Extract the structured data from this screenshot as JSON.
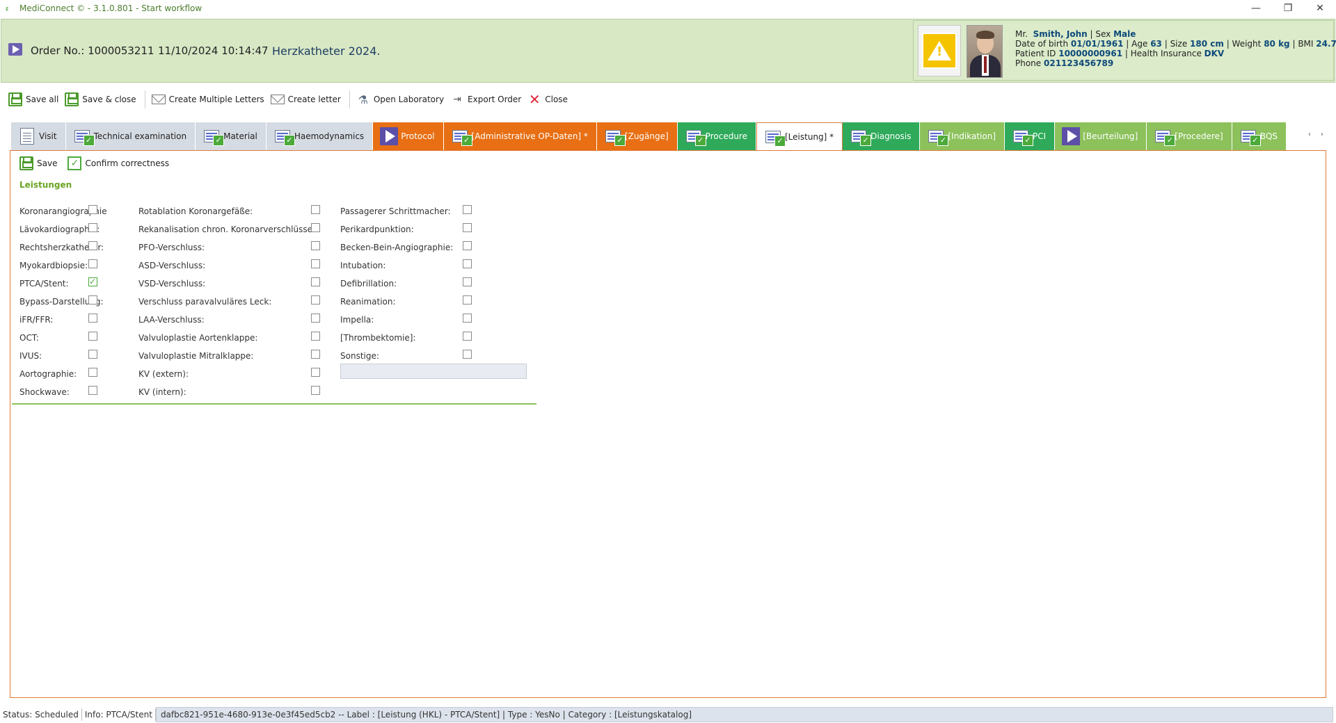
{
  "window": {
    "title": "MediConnect © - 3.1.0.801 - Start workflow",
    "controls": [
      "minimize",
      "restore",
      "close"
    ]
  },
  "header": {
    "order_label": "Order No.: 1000053211",
    "order_datetime": "11/10/2024 10:14:47",
    "workflow_name": "Herzkatheter 2024."
  },
  "patient": {
    "salutation": "Mr.",
    "name": "Smith, John",
    "sex_label": "Sex",
    "sex": "Male",
    "dob_label": "Date of birth",
    "dob": "01/01/1961",
    "age_label": "Age",
    "age": "63",
    "size_label": "Size",
    "size": "180 cm",
    "weight_label": "Weight",
    "weight": "80 kg",
    "bmi_label": "BMI",
    "bmi": "24.7",
    "pid_label": "Patient ID",
    "pid": "10000000961",
    "insurance_label": "Health Insurance",
    "insurance": "DKV",
    "phone_label": "Phone",
    "phone": "021123456789"
  },
  "toolbar": {
    "save_all": "Save all",
    "save_close": "Save & close",
    "create_multiple": "Create Multiple Letters",
    "create_letter": "Create letter",
    "open_lab": "Open Laboratory",
    "export_order": "Export Order",
    "close": "Close"
  },
  "tabs": [
    {
      "label": "Visit",
      "style": "gray",
      "icon": "document-icon"
    },
    {
      "label": "Technical examination",
      "style": "gray",
      "icon": "calendar-check-icon"
    },
    {
      "label": "Material",
      "style": "gray",
      "icon": "calendar-check-icon"
    },
    {
      "label": "Haemodynamics",
      "style": "gray",
      "icon": "calendar-check-icon"
    },
    {
      "label": "Protocol",
      "style": "orange",
      "icon": "play-icon"
    },
    {
      "label": "[Administrative OP-Daten] *",
      "style": "orange",
      "icon": "calendar-check-icon"
    },
    {
      "label": "[Zugänge]",
      "style": "orange",
      "icon": "calendar-check-icon"
    },
    {
      "label": "Procedure",
      "style": "green",
      "icon": "calendar-check-icon"
    },
    {
      "label": "[Leistung] *",
      "style": "active",
      "icon": "calendar-check-icon"
    },
    {
      "label": "Diagnosis",
      "style": "green",
      "icon": "calendar-check-icon"
    },
    {
      "label": "[Indikation]",
      "style": "olive",
      "icon": "calendar-check-icon"
    },
    {
      "label": "PCI",
      "style": "green",
      "icon": "calendar-check-icon"
    },
    {
      "label": "[Beurteilung]",
      "style": "olive",
      "icon": "play-icon"
    },
    {
      "label": "[Procedere]",
      "style": "olive",
      "icon": "calendar-check-icon"
    },
    {
      "label": "BQS",
      "style": "olive",
      "icon": "calendar-check-icon"
    }
  ],
  "tab_nav": {
    "prev": "‹",
    "next": "›"
  },
  "panel": {
    "save": "Save",
    "confirm": "Confirm correctness",
    "section_title": "Leistungen"
  },
  "form": {
    "col1": [
      {
        "label": "Koronarangiographie",
        "checked": false
      },
      {
        "label": "Lävokardiographie:",
        "checked": false
      },
      {
        "label": "Rechtsherzkatheter:",
        "checked": false
      },
      {
        "label": "Myokardbiopsie:",
        "checked": false
      },
      {
        "label": "PTCA/Stent:",
        "checked": true
      },
      {
        "label": "Bypass-Darstellung:",
        "checked": false
      },
      {
        "label": "iFR/FFR:",
        "checked": false
      },
      {
        "label": "OCT:",
        "checked": false
      },
      {
        "label": "IVUS:",
        "checked": false
      },
      {
        "label": "Aortographie:",
        "checked": false
      },
      {
        "label": "Shockwave:",
        "checked": false
      }
    ],
    "col2": [
      {
        "label": "Rotablation Koronargefäße:",
        "checked": false
      },
      {
        "label": "Rekanalisation chron. Koronarverschlüsse:",
        "checked": false
      },
      {
        "label": "PFO-Verschluss:",
        "checked": false
      },
      {
        "label": "ASD-Verschluss:",
        "checked": false
      },
      {
        "label": "VSD-Verschluss:",
        "checked": false
      },
      {
        "label": "Verschluss paravalvuläres Leck:",
        "checked": false
      },
      {
        "label": "LAA-Verschluss:",
        "checked": false
      },
      {
        "label": "Valvuloplastie Aortenklappe:",
        "checked": false
      },
      {
        "label": "Valvuloplastie Mitralklappe:",
        "checked": false
      },
      {
        "label": "KV (extern):",
        "checked": false
      },
      {
        "label": "KV (intern):",
        "checked": false
      }
    ],
    "col3": [
      {
        "label": "Passagerer Schrittmacher:",
        "checked": false
      },
      {
        "label": "Perikardpunktion:",
        "checked": false
      },
      {
        "label": "Becken-Bein-Angiographie:",
        "checked": false
      },
      {
        "label": "Intubation:",
        "checked": false
      },
      {
        "label": "Defibrillation:",
        "checked": false
      },
      {
        "label": "Reanimation:",
        "checked": false
      },
      {
        "label": "Impella:",
        "checked": false
      },
      {
        "label": "[Thrombektomie]:",
        "checked": false
      },
      {
        "label": "Sonstige:",
        "checked": false
      }
    ],
    "sonstige_value": ""
  },
  "status": {
    "status": "Status: Scheduled",
    "info": "Info: PTCA/Stent",
    "detail": "dafbc821-951e-4680-913e-0e3f45ed5cb2  -- Label : [Leistung (HKL) - PTCA/Stent] | Type : YesNo | Category : [Leistungskatalog]"
  }
}
